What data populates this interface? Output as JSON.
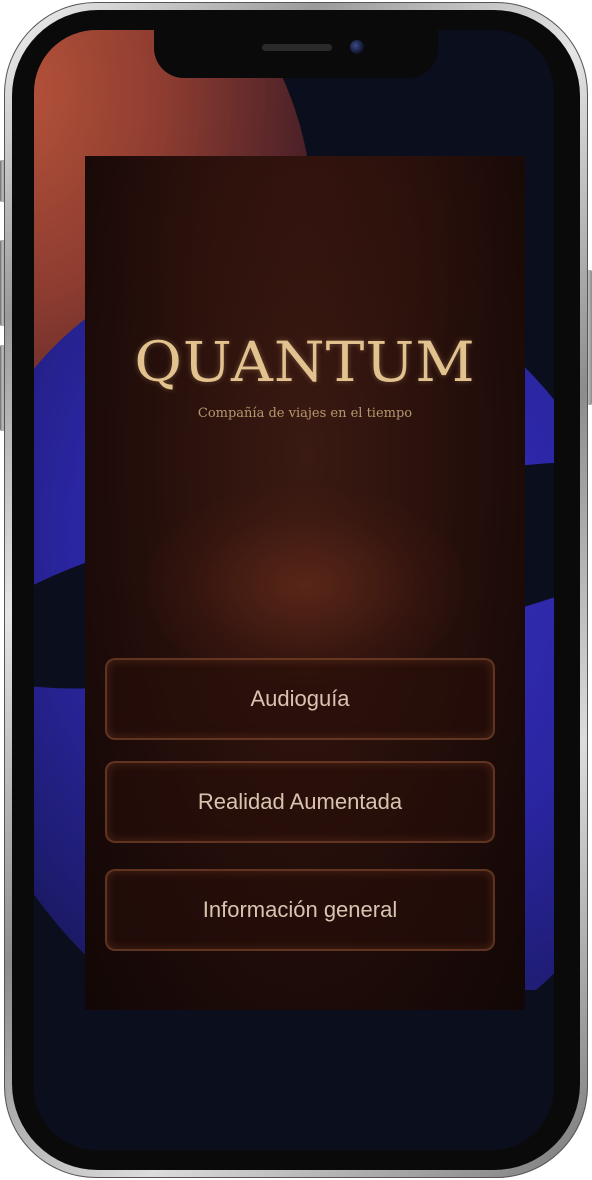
{
  "device": {
    "model": "smartphone mockup",
    "frame_color": "#c8c8c8",
    "wallpaper_colors": [
      "#b5523a",
      "#2a25a0",
      "#0b0e1c"
    ]
  },
  "app": {
    "logo_text": "QUANTUM",
    "tagline": "Compañía de viajes en el tiempo",
    "accent_color": "#e2c28e",
    "menu": [
      {
        "label": "Audioguía"
      },
      {
        "label": "Realidad Aumentada"
      },
      {
        "label": "Información general"
      }
    ]
  }
}
